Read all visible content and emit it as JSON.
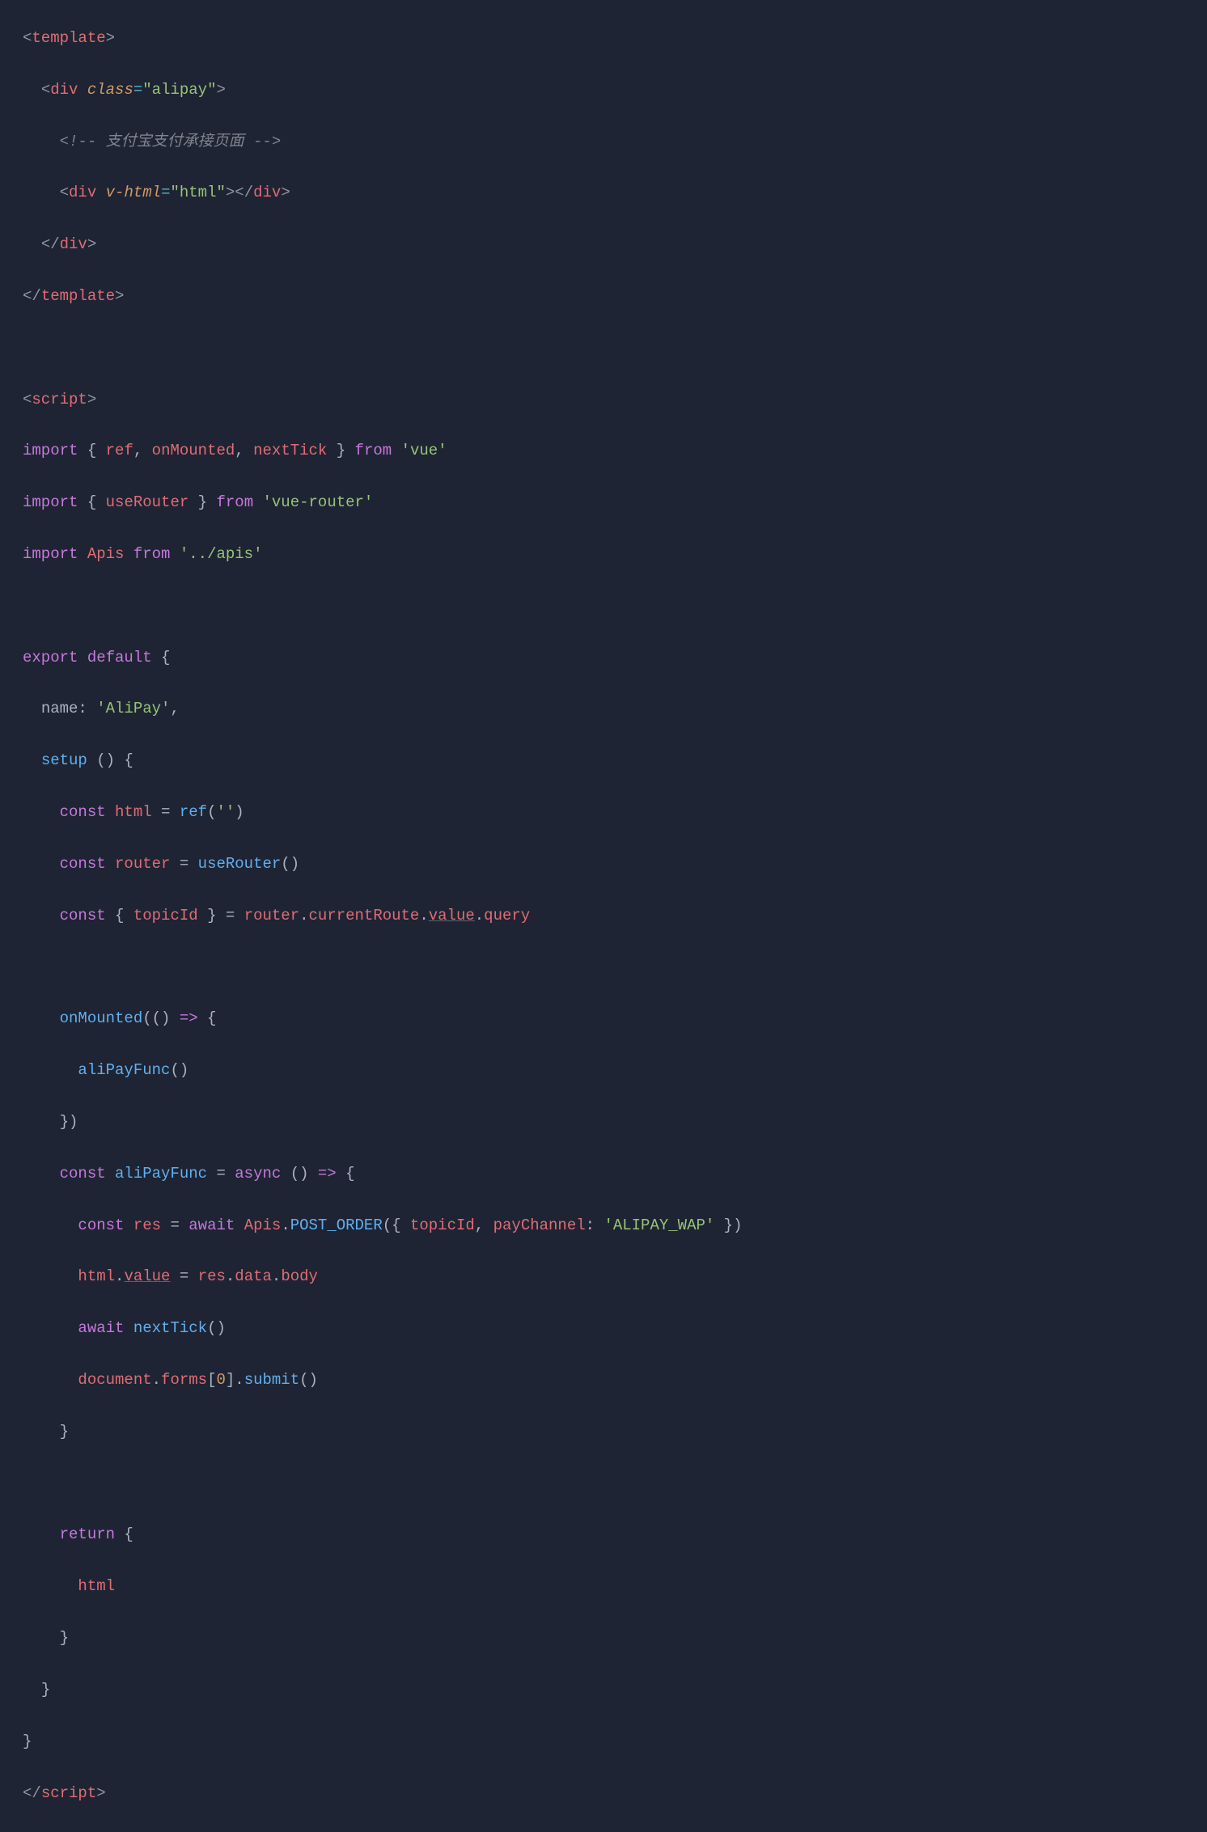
{
  "lines": {
    "l1_open": "<",
    "l1_tag": "template",
    "l1_close": ">",
    "l2_open": "<",
    "l2_tag": "div",
    "l2_sp": " ",
    "l2_attr": "class",
    "l2_eq": "=",
    "l2_val": "\"alipay\"",
    "l2_close": ">",
    "l3_comment": "<!-- 支付宝支付承接页面 -->",
    "l4_open": "<",
    "l4_tag": "div",
    "l4_sp": " ",
    "l4_attr": "v-html",
    "l4_eq": "=",
    "l4_val": "\"html\"",
    "l4_close": ">",
    "l4_open2": "</",
    "l4_tag2": "div",
    "l4_close2": ">",
    "l5_open": "</",
    "l5_tag": "div",
    "l5_close": ">",
    "l6_open": "</",
    "l6_tag": "template",
    "l6_close": ">",
    "l8_open": "<",
    "l8_tag": "script",
    "l8_close": ">",
    "l9_import": "import",
    "l9_b1": " { ",
    "l9_i1": "ref",
    "l9_c1": ", ",
    "l9_i2": "onMounted",
    "l9_c2": ", ",
    "l9_i3": "nextTick",
    "l9_b2": " } ",
    "l9_from": "from",
    "l9_sp": " ",
    "l9_str": "'vue'",
    "l10_import": "import",
    "l10_b1": " { ",
    "l10_i1": "useRouter",
    "l10_b2": " } ",
    "l10_from": "from",
    "l10_sp": " ",
    "l10_str": "'vue-router'",
    "l11_import": "import",
    "l11_sp1": " ",
    "l11_i1": "Apis",
    "l11_sp2": " ",
    "l11_from": "from",
    "l11_sp3": " ",
    "l11_str": "'../apis'",
    "l13_export": "export",
    "l13_sp": " ",
    "l13_default": "default",
    "l13_b": " {",
    "l14_key": "name",
    "l14_colon": ": ",
    "l14_val": "'AliPay'",
    "l14_comma": ",",
    "l15_func": "setup",
    "l15_paren": " () {",
    "l16_const": "const",
    "l16_sp": " ",
    "l16_id": "html",
    "l16_eq": " = ",
    "l16_fn": "ref",
    "l16_p1": "(",
    "l16_str": "''",
    "l16_p2": ")",
    "l17_const": "const",
    "l17_sp": " ",
    "l17_id": "router",
    "l17_eq": " = ",
    "l17_fn": "useRouter",
    "l17_p": "()",
    "l18_const": "const",
    "l18_b1": " { ",
    "l18_id": "topicId",
    "l18_b2": " } = ",
    "l18_r": "router",
    "l18_d1": ".",
    "l18_p1": "currentRoute",
    "l18_d2": ".",
    "l18_p2": "value",
    "l18_d3": ".",
    "l18_p3": "query",
    "l20_fn": "onMounted",
    "l20_p1": "(() ",
    "l20_arrow": "=>",
    "l20_b": " {",
    "l21_fn": "aliPayFunc",
    "l21_p": "()",
    "l22_b": "})",
    "l23_const": "const",
    "l23_sp": " ",
    "l23_id": "aliPayFunc",
    "l23_eq": " = ",
    "l23_async": "async",
    "l23_p1": " () ",
    "l23_arrow": "=>",
    "l23_b": " {",
    "l24_const": "const",
    "l24_sp": " ",
    "l24_id": "res",
    "l24_eq": " = ",
    "l24_await": "await",
    "l24_sp2": " ",
    "l24_obj": "Apis",
    "l24_d": ".",
    "l24_fn": "POST_ORDER",
    "l24_p1": "({ ",
    "l24_a1": "topicId",
    "l24_c1": ", ",
    "l24_a2": "payChannel",
    "l24_col": ": ",
    "l24_str": "'ALIPAY_WAP'",
    "l24_p2": " })",
    "l25_a": "html",
    "l25_d1": ".",
    "l25_p1": "value",
    "l25_eq": " = ",
    "l25_b": "res",
    "l25_d2": ".",
    "l25_p2": "data",
    "l25_d3": ".",
    "l25_p3": "body",
    "l26_await": "await",
    "l26_sp": " ",
    "l26_fn": "nextTick",
    "l26_p": "()",
    "l27_a": "document",
    "l27_d1": ".",
    "l27_p1": "forms",
    "l27_b1": "[",
    "l27_n": "0",
    "l27_b2": "].",
    "l27_fn": "submit",
    "l27_p": "()",
    "l28_b": "}",
    "l30_return": "return",
    "l30_b": " {",
    "l31_id": "html",
    "l32_b": "}",
    "l33_b": "}",
    "l34_b": "}",
    "l35_open": "</",
    "l35_tag": "script",
    "l35_close": ">"
  }
}
